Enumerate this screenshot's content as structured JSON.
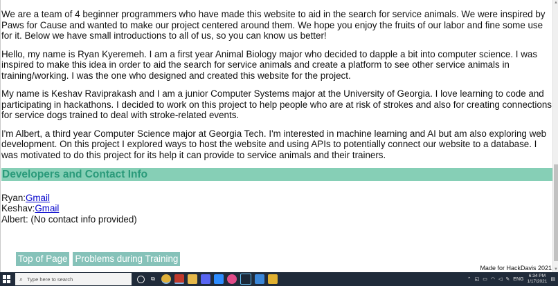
{
  "paragraphs": [
    "We are a team of 4 beginner programmers who have made this website to aid in the search for service animals. We were inspired by Paws for Cause and wanted to make our project centered around them. We hope you enjoy the fruits of our labor and fine some use for it. Below we have small introductions to all of us, so you can know us better!",
    "Hello, my name is Ryan Kyeremeh. I am a first year Animal Biology major who decided to dapple a bit into computer science. I was inspired to make this idea in order to aid the search for service animals and create a platform to see other service animals in training/working. I was the one who designed and created this website for the project.",
    "My name is Keshav Raviprakash and I am a junior Computer Systems major at the University of Georgia. I love learning to code and participating in hackathons. I decided to work on this project to help people who are at risk of strokes and also for creating connections for service dogs trained to deal with stroke-related events.",
    "I'm Albert, a third year Computer Science major at Georgia Tech. I'm interested in machine learning and AI but am also exploring web development. On this project I explored ways to host the website and using APIs to potentially connect our website to a database. I was motivated to do this project for its help it can provide to service animals and their trainers."
  ],
  "section": {
    "heading": "Developers and Contact Info"
  },
  "contacts": {
    "ryan_label": "Ryan:",
    "ryan_link": "Gmail",
    "keshav_label": "Keshav:",
    "keshav_link": "Gmail",
    "albert": "Albert: (No contact info provided)"
  },
  "buttons": {
    "top_of_page": "Top of Page",
    "problems": "Problems during Training"
  },
  "credit": "Made for HackDavis 2021",
  "taskbar": {
    "search_placeholder": "Type here to search",
    "language": "ENG",
    "time": "6:34 PM",
    "date": "1/17/2021"
  },
  "colors": {
    "section_bg": "#86cfb6",
    "section_text": "#2a9a7a",
    "button_bg": "#86c2b9",
    "link": "#0000cc"
  }
}
